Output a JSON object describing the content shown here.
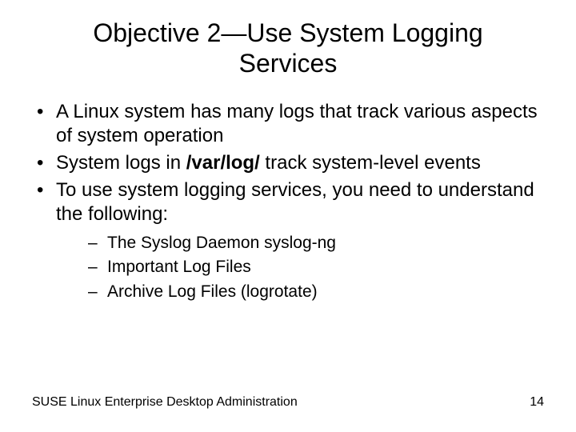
{
  "title": "Objective 2—Use System Logging Services",
  "bullets": [
    {
      "text": "A Linux system has many logs that track various aspects of system operation"
    },
    {
      "pre": "System logs in ",
      "bold": "/var/log/",
      "post": " track system-level events"
    },
    {
      "text": "To use system logging services, you need to understand the following:"
    }
  ],
  "sub": [
    "The Syslog Daemon syslog-ng",
    "Important Log Files",
    "Archive Log Files (logrotate)"
  ],
  "footer": "SUSE Linux Enterprise Desktop Administration",
  "page": "14"
}
